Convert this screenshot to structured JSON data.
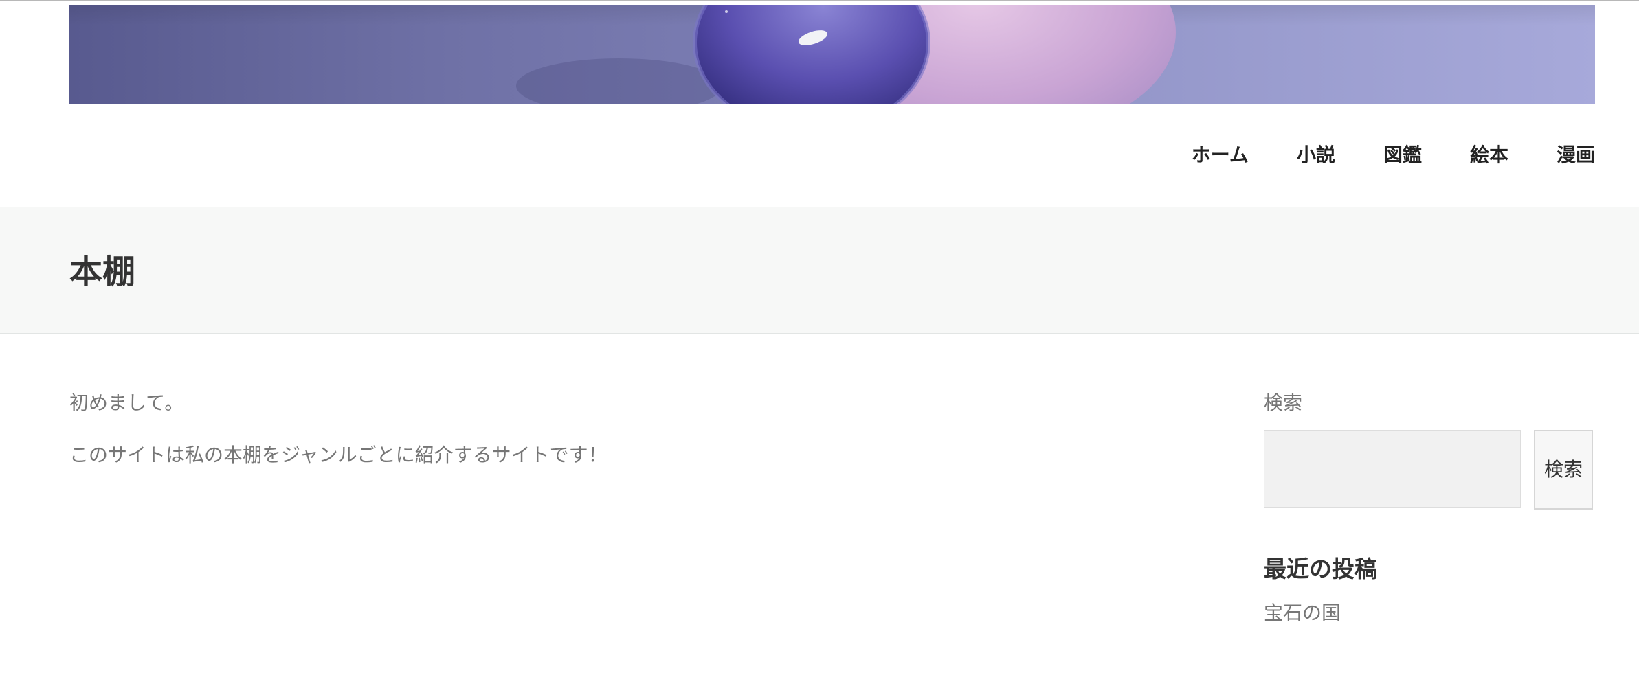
{
  "header": {
    "nav": {
      "items": [
        {
          "label": "ホーム"
        },
        {
          "label": "小説"
        },
        {
          "label": "図鑑"
        },
        {
          "label": "絵本"
        },
        {
          "label": "漫画"
        }
      ]
    }
  },
  "page": {
    "title": "本棚"
  },
  "content": {
    "paragraphs": [
      "初めまして。",
      "このサイトは私の本棚をジャンルごとに紹介するサイトです！"
    ]
  },
  "sidebar": {
    "search": {
      "label": "検索",
      "input_value": "",
      "button_label": "検索"
    },
    "recent_posts": {
      "heading": "最近の投稿",
      "items": [
        {
          "title": "宝石の国"
        }
      ]
    }
  },
  "colors": {
    "banner_dark": "#5d5f95",
    "banner_light": "#a5a7d8",
    "text_muted": "#767676",
    "heading": "#333333",
    "page_header_bg": "#f7f8f7"
  }
}
